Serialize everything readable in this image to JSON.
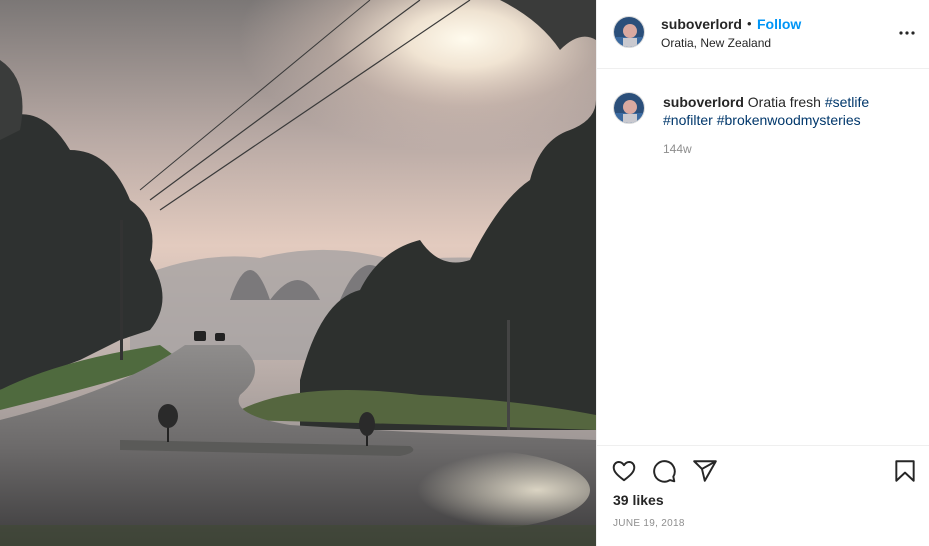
{
  "post": {
    "image_alt": "Misty road at sunrise",
    "username": "suboverlord",
    "separator": "•",
    "follow_label": "Follow",
    "location": "Oratia, New Zealand",
    "more_icon": "more-options-icon"
  },
  "caption": {
    "username": "suboverlord",
    "text": "Oratia fresh",
    "hashtags": [
      "#setlife",
      "#nofilter",
      "#brokenwoodmysteries"
    ],
    "age": "144w"
  },
  "actions": {
    "icons": [
      "heart-icon",
      "comment-icon",
      "share-icon",
      "bookmark-icon"
    ],
    "likes": "39 likes",
    "date": "JUNE 19, 2018"
  },
  "colors": {
    "link": "#0095f6",
    "hashtag": "#00376b",
    "muted": "#8e8e8e",
    "border": "#efefef"
  }
}
